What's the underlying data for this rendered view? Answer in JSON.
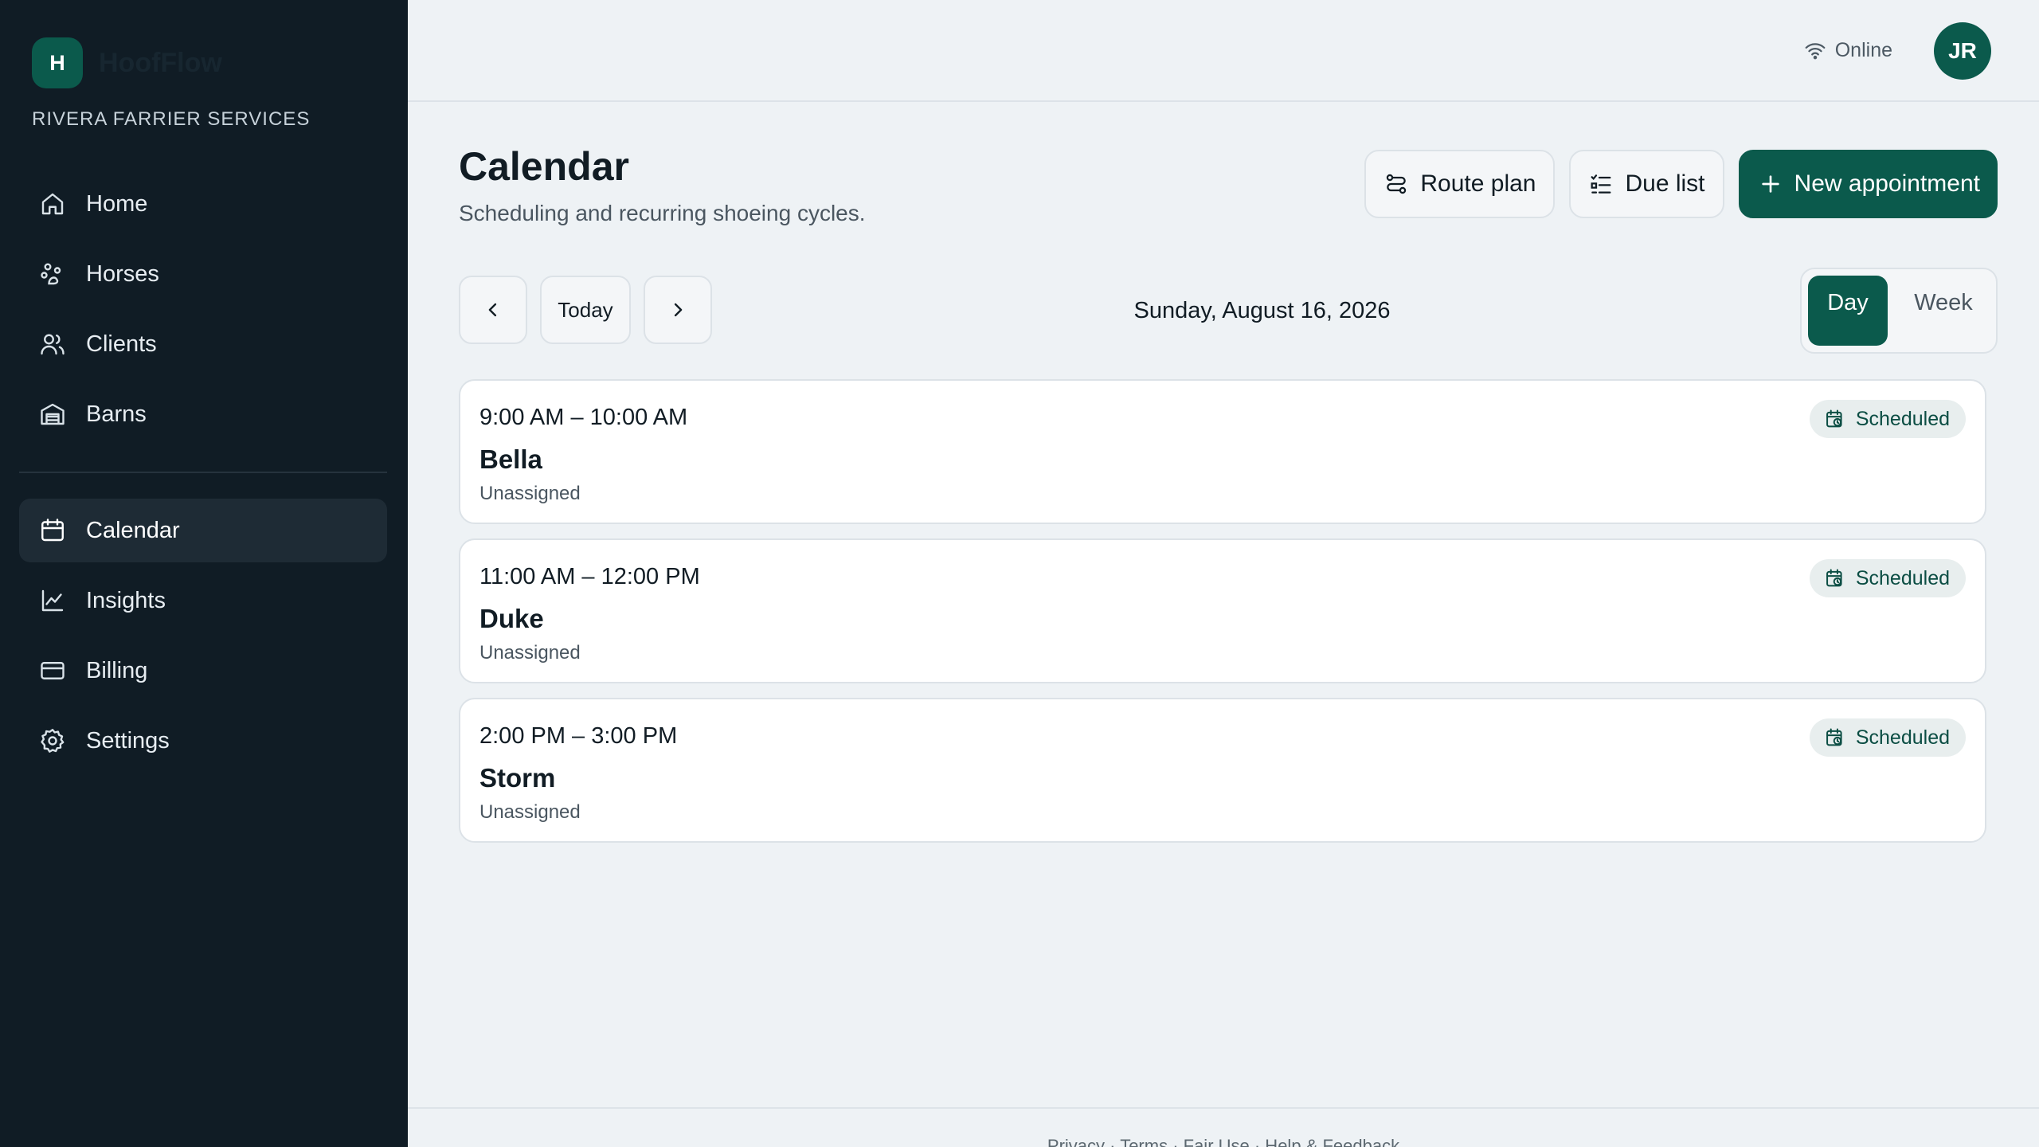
{
  "brand": {
    "logo_letter": "H",
    "name": "HoofFlow",
    "org": "RIVERA FARRIER SERVICES"
  },
  "sidebar": {
    "primary": [
      {
        "label": "Home",
        "icon": "home-icon"
      },
      {
        "label": "Horses",
        "icon": "horse-icon"
      },
      {
        "label": "Clients",
        "icon": "clients-icon"
      },
      {
        "label": "Barns",
        "icon": "barn-icon"
      }
    ],
    "secondary": [
      {
        "label": "Calendar",
        "icon": "calendar-icon",
        "active": true
      },
      {
        "label": "Insights",
        "icon": "chart-icon"
      },
      {
        "label": "Billing",
        "icon": "credit-card-icon"
      },
      {
        "label": "Settings",
        "icon": "gear-icon"
      }
    ]
  },
  "topbar": {
    "status": "Online",
    "avatar_initials": "JR"
  },
  "page": {
    "title": "Calendar",
    "subtitle": "Scheduling and recurring shoeing cycles.",
    "actions": {
      "route_plan": "Route plan",
      "due_list": "Due list",
      "new_appointment": "New appointment"
    },
    "nav": {
      "today": "Today"
    },
    "current_date": "Sunday, August 16, 2026",
    "view": {
      "day": "Day",
      "week": "Week",
      "selected": "Day"
    }
  },
  "appointments": [
    {
      "time": "9:00 AM – 10:00 AM",
      "horse": "Bella",
      "assignee": "Unassigned",
      "status": "Scheduled"
    },
    {
      "time": "11:00 AM – 12:00 PM",
      "horse": "Duke",
      "assignee": "Unassigned",
      "status": "Scheduled"
    },
    {
      "time": "2:00 PM – 3:00 PM",
      "horse": "Storm",
      "assignee": "Unassigned",
      "status": "Scheduled"
    }
  ],
  "footer": {
    "links": "Privacy · Terms · Fair Use · Help & Feedback"
  },
  "colors": {
    "accent": "#0b5a4c",
    "sidebar_bg": "#101c25",
    "page_bg": "#eef2f5"
  }
}
